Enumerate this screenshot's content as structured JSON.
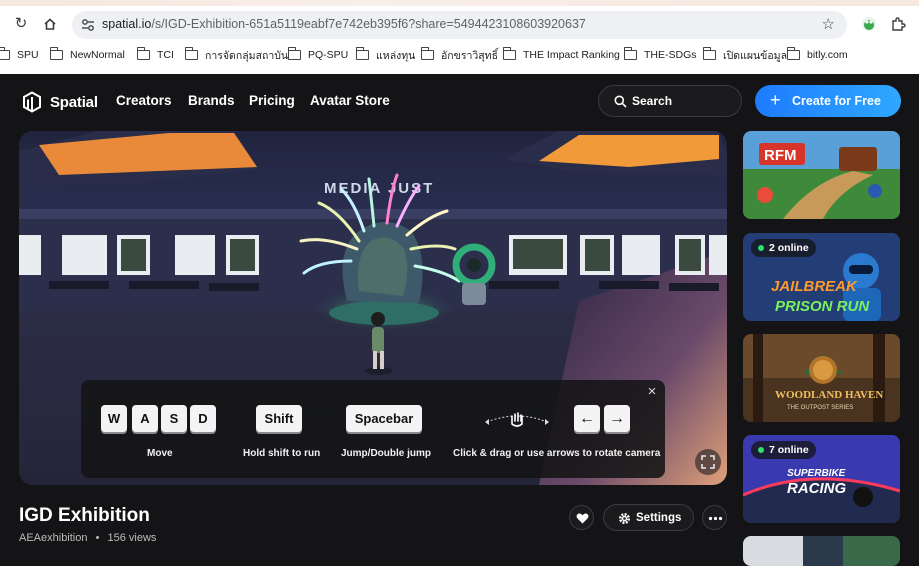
{
  "browser": {
    "url_host": "spatial.io",
    "url_path": "/s/IGD-Exhibition-651a5119eabf7e742eb395f6?share=5494423108603920637",
    "bookmarks": [
      "SPU",
      "NewNormal",
      "TCI",
      "การจัดกลุ่มสถาบัน",
      "PQ-SPU",
      "แหล่งทุน",
      "อักขราวิสุทธิ์",
      "THE Impact Ranking",
      "THE-SDGs",
      "เปิดแผนข้อมูล",
      "bitly.com"
    ]
  },
  "header": {
    "logo_text": "Spatial",
    "nav": [
      "Creators",
      "Brands",
      "Pricing",
      "Avatar Store"
    ],
    "search_label": "Search",
    "create_label": "Create for Free"
  },
  "controls": {
    "keys_move": [
      "W",
      "A",
      "S",
      "D"
    ],
    "move_label": "Move",
    "shift_key": "Shift",
    "shift_label": "Hold shift to run",
    "space_key": "Spacebar",
    "space_label": "Jump/Double jump",
    "arrow_left": "←",
    "arrow_right": "→",
    "camera_label": "Click & drag or use arrows to rotate camera"
  },
  "space": {
    "title": "IGD Exhibition",
    "owner": "AEAexhibition",
    "views": "156 views",
    "settings_label": "Settings"
  },
  "sidebar": [
    {
      "name": "rfm-thumbnail",
      "online": ""
    },
    {
      "name": "jailbreak-thumbnail",
      "online": "2 online"
    },
    {
      "name": "woodland-haven-thumbnail",
      "online": ""
    },
    {
      "name": "superbike-racing-thumbnail",
      "online": "7 online"
    }
  ],
  "colors": {
    "accent": "#1e7bff",
    "page_bg": "#141416",
    "online_dot": "#2ee06b"
  }
}
